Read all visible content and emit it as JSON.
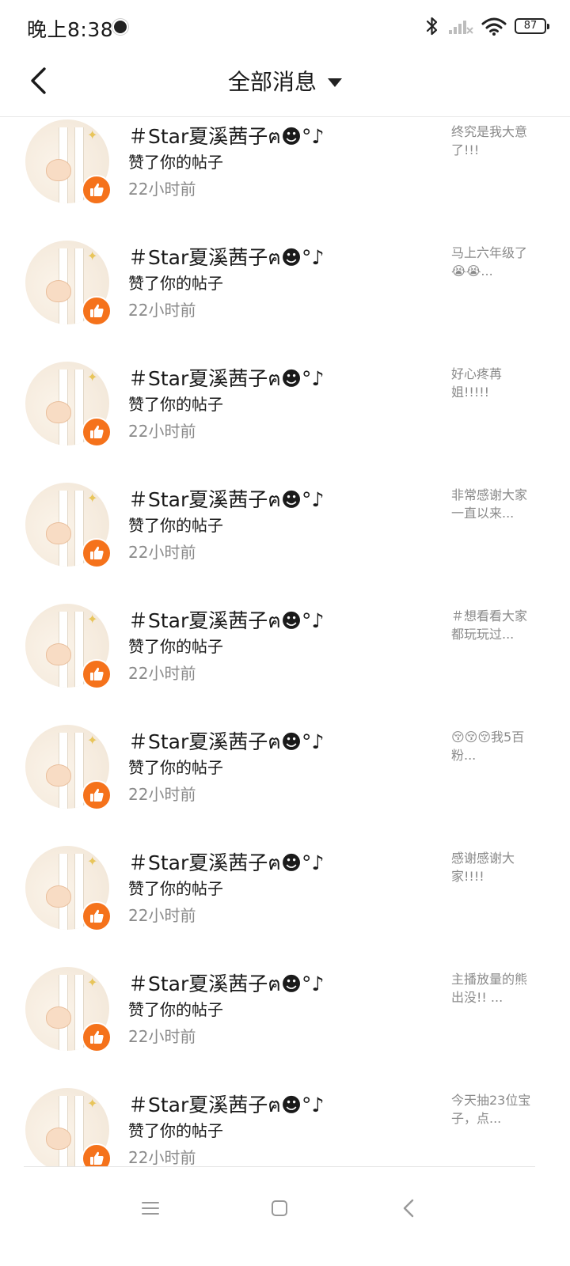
{
  "status_bar": {
    "time": "晚上8:38",
    "battery": "87"
  },
  "header": {
    "title": "全部消息"
  },
  "list": {
    "items": [
      {
        "name": "＃Star夏溪茜子ฅ☻°♪",
        "action": "赞了你的帖子",
        "time": "22小时前",
        "preview": "终究是我大意了!!!"
      },
      {
        "name": "＃Star夏溪茜子ฅ☻°♪",
        "action": "赞了你的帖子",
        "time": "22小时前",
        "preview": "马上六年级了😭😭..."
      },
      {
        "name": "＃Star夏溪茜子ฅ☻°♪",
        "action": "赞了你的帖子",
        "time": "22小时前",
        "preview": "好心疼苒姐!!!!!"
      },
      {
        "name": "＃Star夏溪茜子ฅ☻°♪",
        "action": "赞了你的帖子",
        "time": "22小时前",
        "preview": "非常感谢大家一直以来..."
      },
      {
        "name": "＃Star夏溪茜子ฅ☻°♪",
        "action": "赞了你的帖子",
        "time": "22小时前",
        "preview": "＃想看看大家都玩玩过..."
      },
      {
        "name": "＃Star夏溪茜子ฅ☻°♪",
        "action": "赞了你的帖子",
        "time": "22小时前",
        "preview": "😚😚😚我5百粉..."
      },
      {
        "name": "＃Star夏溪茜子ฅ☻°♪",
        "action": "赞了你的帖子",
        "time": "22小时前",
        "preview": "感谢感谢大家!!!!"
      },
      {
        "name": "＃Star夏溪茜子ฅ☻°♪",
        "action": "赞了你的帖子",
        "time": "22小时前",
        "preview": "主播放量的熊出没!! ..."
      },
      {
        "name": "＃Star夏溪茜子ฅ☻°♪",
        "action": "赞了你的帖子",
        "time": "22小时前",
        "preview": "今天抽23位宝子，点..."
      }
    ]
  },
  "colors": {
    "like_badge": "#f5721b",
    "secondary_text": "#8a8a8a",
    "primary_text": "#1a1a1a"
  },
  "icons": {
    "back": "chevron-left-icon",
    "dropdown": "caret-down-icon",
    "like": "thumbs-up-icon",
    "nav_menu": "menu-icon",
    "nav_home": "square-icon",
    "nav_back": "back-triangle-icon"
  }
}
